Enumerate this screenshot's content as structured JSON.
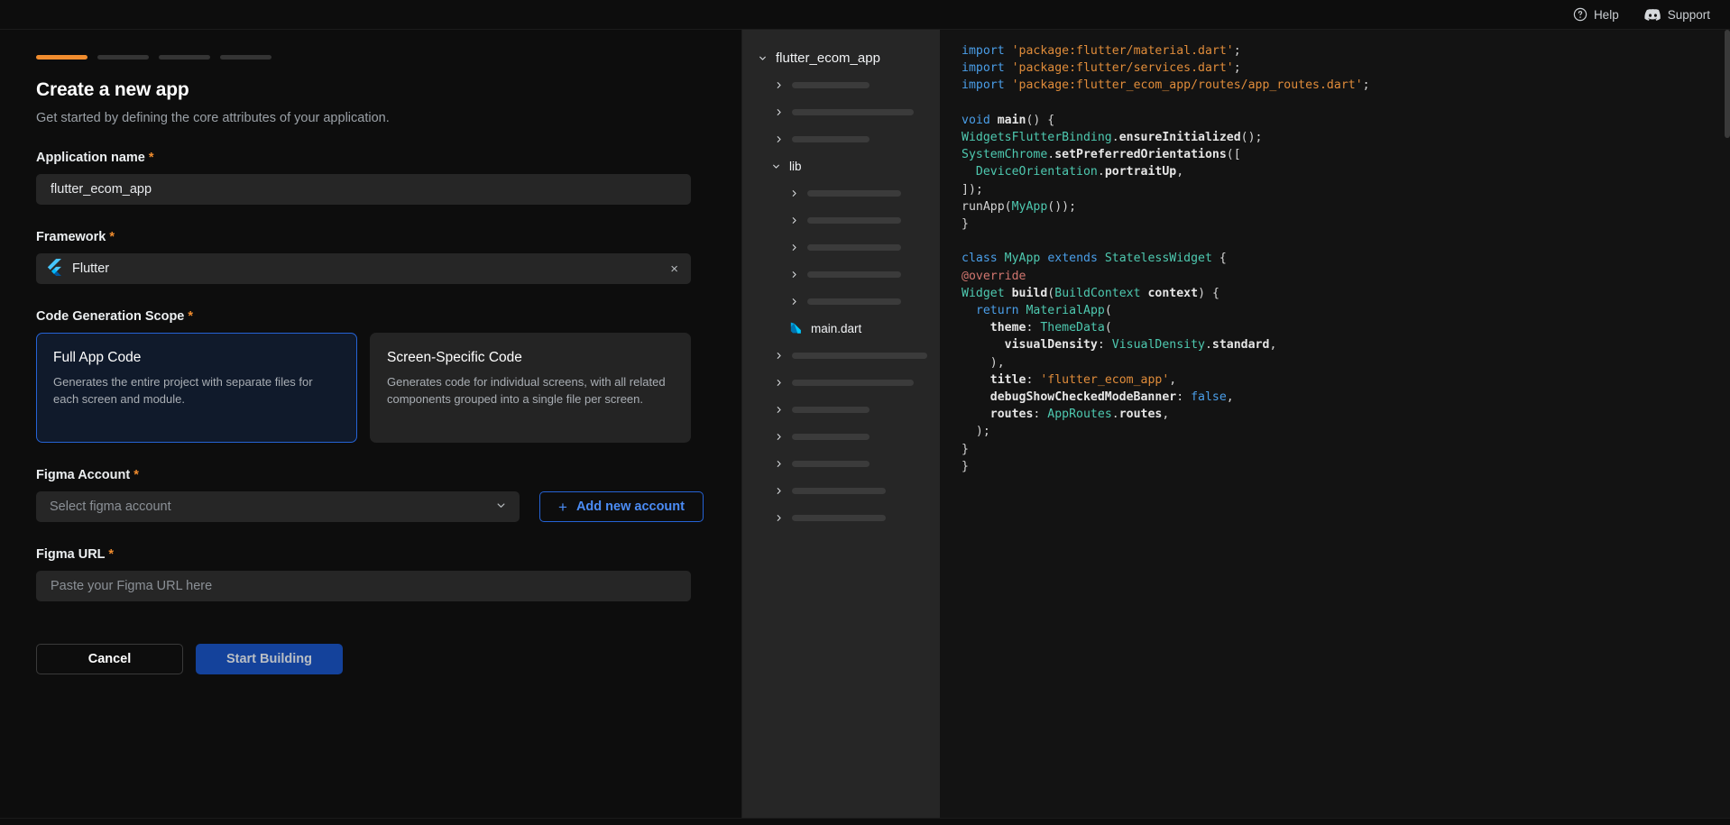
{
  "topbar": {
    "help_label": "Help",
    "support_label": "Support"
  },
  "wizard": {
    "steps": [
      {
        "active": true
      },
      {
        "active": false
      },
      {
        "active": false
      },
      {
        "active": false
      }
    ],
    "title": "Create a new app",
    "subtitle": "Get started by defining the core attributes of your application.",
    "required_marker": "*"
  },
  "form": {
    "app_name": {
      "label": "Application name",
      "value": "flutter_ecom_app"
    },
    "framework": {
      "label": "Framework",
      "value": "Flutter",
      "icon": "flutter-logo-icon",
      "clear_glyph": "×"
    },
    "scope": {
      "label": "Code Generation Scope",
      "options": [
        {
          "title": "Full App Code",
          "description": "Generates the entire project with separate files for each screen and module.",
          "selected": true
        },
        {
          "title": "Screen-Specific Code",
          "description": "Generates code for individual screens, with all related components grouped into a single file per screen.",
          "selected": false
        }
      ]
    },
    "figma_account": {
      "label": "Figma Account",
      "placeholder": "Select figma account",
      "add_button": "Add new account",
      "add_glyph": "+"
    },
    "figma_url": {
      "label": "Figma URL",
      "placeholder": "Paste your Figma URL here",
      "value": ""
    }
  },
  "actions": {
    "cancel": "Cancel",
    "start": "Start Building"
  },
  "file_tree": {
    "root": "flutter_ecom_app",
    "lib_label": "lib",
    "main_file": "main.dart",
    "main_file_icon": "dart-logo-icon"
  },
  "editor": {
    "filename": "main.dart",
    "lines": [
      "import 'package:flutter/material.dart';",
      "import 'package:flutter/services.dart';",
      "import 'package:flutter_ecom_app/routes/app_routes.dart';",
      "",
      "void main() {",
      "WidgetsFlutterBinding.ensureInitialized();",
      "SystemChrome.setPreferredOrientations([",
      "  DeviceOrientation.portraitUp,",
      "]);",
      "runApp(MyApp());",
      "}",
      "",
      "class MyApp extends StatelessWidget {",
      "@override",
      "Widget build(BuildContext context) {",
      "  return MaterialApp(",
      "    theme: ThemeData(",
      "      visualDensity: VisualDensity.standard,",
      "    ),",
      "    title: 'flutter_ecom_app',",
      "    debugShowCheckedModeBanner: false,",
      "    routes: AppRoutes.routes,",
      "  );",
      "}",
      "}"
    ]
  },
  "colors": {
    "accent_orange": "#f08c2e",
    "accent_blue": "#2563d6",
    "primary_button": "#14429b",
    "panel": "#262626",
    "background": "#0d0d0d",
    "code_background": "#131313"
  }
}
